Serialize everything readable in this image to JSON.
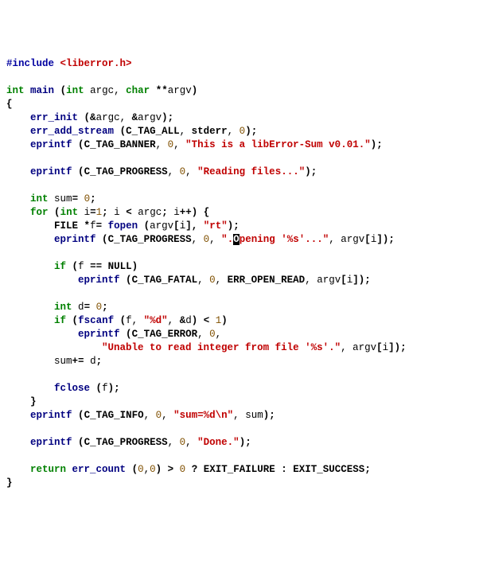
{
  "code": {
    "include_kw": "#include",
    "include_hdr": "<liberror.h>",
    "int": "int",
    "main": "main",
    "argc": "argc",
    "char": "char",
    "argv": "argv",
    "err_init": "err_init",
    "err_add_stream": "err_add_stream",
    "C_TAG_ALL": "C_TAG_ALL",
    "stderr": "stderr",
    "zero": "0",
    "eprintf": "eprintf",
    "C_TAG_BANNER": "C_TAG_BANNER",
    "str_banner": "\"This is a libError-Sum v0.01.\"",
    "C_TAG_PROGRESS": "C_TAG_PROGRESS",
    "str_reading": "\"Reading files...\"",
    "sum": "sum",
    "for": "for",
    "i": "i",
    "one": "1",
    "FILE": "FILE",
    "f": "f",
    "fopen": "fopen",
    "str_rt": "\"rt\"",
    "str_open_pre": "\"",
    "str_open_dot": ".",
    "str_open_curs": "O",
    "str_open_rest": "pening '%s'...\"",
    "if": "if",
    "NULL": "NULL",
    "C_TAG_FATAL": "C_TAG_FATAL",
    "ERR_OPEN_READ": "ERR_OPEN_READ",
    "d": "d",
    "fscanf": "fscanf",
    "str_pd": "\"%d\"",
    "amp_d": "&d",
    "C_TAG_ERROR": "C_TAG_ERROR",
    "str_unable": "\"Unable to read integer from file '%s'.\"",
    "fclose": "fclose",
    "C_TAG_INFO": "C_TAG_INFO",
    "str_sum": "\"sum=%d\\n\"",
    "str_done": "\"Done.\"",
    "return": "return",
    "err_count": "err_count",
    "q": "?",
    "EXIT_FAILURE": "EXIT_FAILURE",
    "colon": ":",
    "EXIT_SUCCESS": "EXIT_SUCCESS"
  }
}
